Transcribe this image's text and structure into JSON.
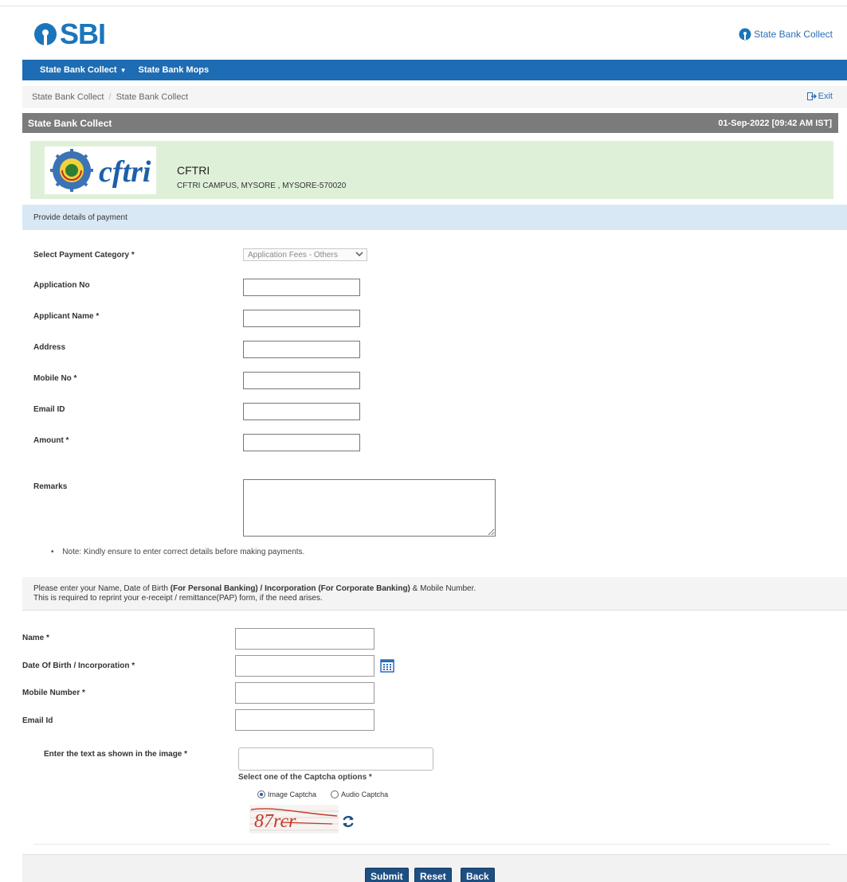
{
  "header": {
    "logo_text": "SBI",
    "brand_right": "State Bank Collect"
  },
  "nav": {
    "items": [
      {
        "label": "State Bank Collect",
        "has_caret": true
      },
      {
        "label": "State Bank Mops",
        "has_caret": false
      }
    ]
  },
  "breadcrumb": {
    "items": [
      "State Bank Collect",
      "State Bank Collect"
    ],
    "exit_label": "Exit"
  },
  "titlebar": {
    "title": "State Bank Collect",
    "timestamp": "01-Sep-2022 [09:42 AM IST]"
  },
  "merchant": {
    "logo_text": "cftri",
    "name": "CFTRI",
    "address": "CFTRI CAMPUS, MYSORE , MYSORE-570020"
  },
  "payment_section": {
    "heading": "Provide details of payment",
    "category_label": "Select Payment Category *",
    "category_value": "Application Fees - Others",
    "fields": [
      {
        "label": "Application No",
        "value": ""
      },
      {
        "label": "Applicant Name *",
        "value": ""
      },
      {
        "label": "Address",
        "value": ""
      },
      {
        "label": "Mobile No *",
        "value": ""
      },
      {
        "label": "Email ID",
        "value": ""
      },
      {
        "label": "Amount *",
        "value": ""
      }
    ],
    "remarks_label": "Remarks",
    "note": "Note: Kindly ensure to enter correct details before making payments."
  },
  "reprint_section": {
    "line1_a": "Please enter your Name, Date of Birth ",
    "line1_b": "(For Personal Banking) / Incorporation (For Corporate Banking)",
    "line1_c": " & Mobile Number.",
    "line2": "This is required to reprint your e-receipt / remittance(PAP) form, if the need arises.",
    "fields": [
      {
        "label": "Name *",
        "value": ""
      },
      {
        "label": "Date Of Birth / Incorporation *",
        "value": ""
      },
      {
        "label": "Mobile Number *",
        "value": ""
      },
      {
        "label": "Email Id",
        "value": ""
      }
    ]
  },
  "captcha": {
    "label": "Enter the text as shown in the image *",
    "value": "",
    "options_label": "Select one of the Captcha options *",
    "option_image": "Image Captcha",
    "option_audio": "Audio Captcha",
    "selected": "image",
    "captcha_text": "87rcr"
  },
  "buttons": {
    "submit": "Submit",
    "reset": "Reset",
    "back": "Back"
  },
  "colors": {
    "primary": "#1e6cb3",
    "title_bar": "#7b7b7b",
    "merchant_bg": "#dff0d8",
    "section_bg": "#d9e8f5"
  }
}
